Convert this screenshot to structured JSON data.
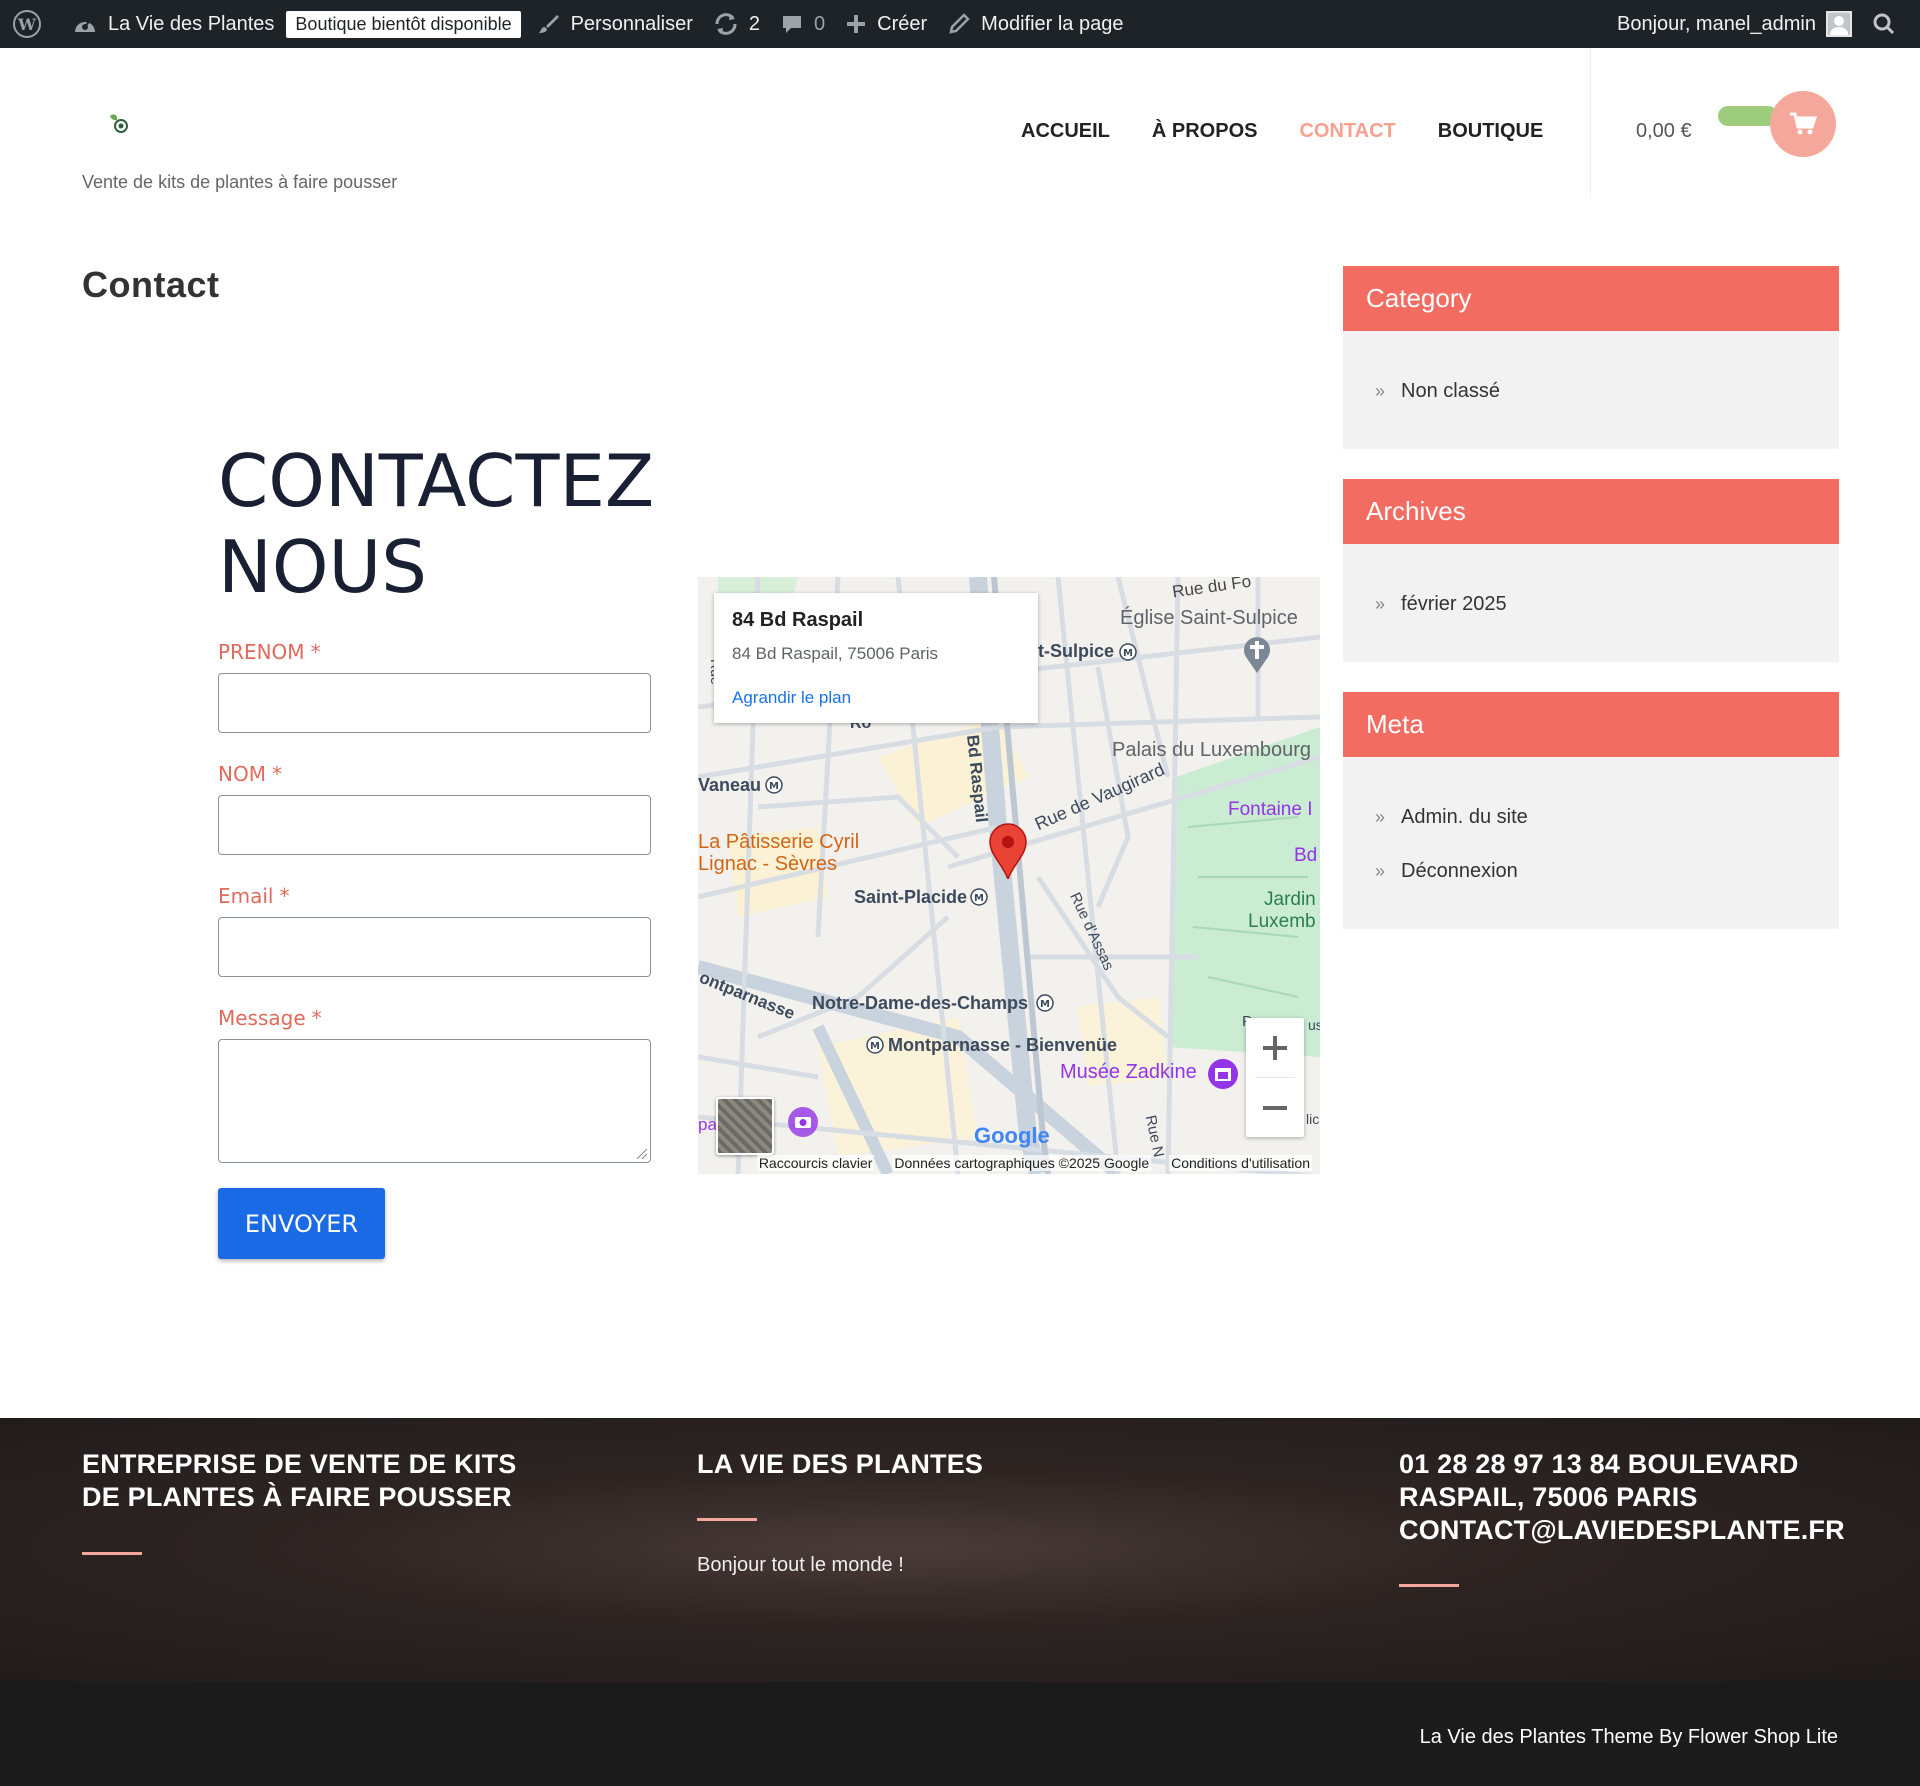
{
  "admin_bar": {
    "site_name": "La Vie des Plantes",
    "shop_badge": "Boutique bientôt disponible",
    "customize": "Personnaliser",
    "updates_count": "2",
    "comments_count": "0",
    "new": "Créer",
    "edit_page": "Modifier la page",
    "greeting": "Bonjour, manel_admin"
  },
  "header": {
    "tagline": "Vente de kits de plantes à faire pousser",
    "nav": [
      "ACCUEIL",
      "À PROPOS",
      "CONTACT",
      "BOUTIQUE"
    ],
    "active_nav": "CONTACT",
    "cart_total": "0,00 €"
  },
  "page": {
    "title": "Contact"
  },
  "contact_form": {
    "heading_line1": "CONTACTEZ",
    "heading_line2": "NOUS",
    "fields": [
      {
        "label": "PRENOM",
        "required": "*"
      },
      {
        "label": "NOM",
        "required": "*"
      },
      {
        "label": "Email",
        "required": "*"
      },
      {
        "label": "Message",
        "required": "*"
      }
    ],
    "submit": "ENVOYER"
  },
  "map": {
    "place_title": "84 Bd Raspail",
    "place_address": "84 Bd Raspail, 75006 Paris",
    "enlarge_link": "Agrandir le plan",
    "labels": {
      "rue_du_four": "Rue du Fo",
      "eglise": "Église Saint-Sulpice",
      "st_sulpice": "t-Sulpice",
      "palais": "Palais du Luxembourg",
      "vaneau": "Vaneau",
      "fontaine": "Fontaine I",
      "bd": "Bd",
      "jardin1": "Jardin",
      "jardin2": "Luxemb",
      "patisserie1": "La Pâtisserie Cyril",
      "patisserie2": "Lignac - Sèvres",
      "rue_vaugirard": "Rue de Vaugirard",
      "rue_assas": "Rue d'Assas",
      "bd_raspail": "Bd Raspail",
      "saint_placide": "Saint-Placide",
      "montparnasse_street": "ontparnasse",
      "notre_dame": "Notre-Dame-des-Champs",
      "montparnasse_station": "Montparnasse - Bienvenüe",
      "musee": "Musée Zadkine",
      "google": "Google",
      "rue_n": "Rue N",
      "us_fragment": "us",
      "lic_fragment": "lic",
      "pa_fragment": "pa",
      "rue_fragment": "Rue",
      "ro_fragment": "Ro",
      "p_fragment": "P"
    },
    "footer": {
      "shortcuts": "Raccourcis clavier",
      "data": "Données cartographiques ©2025 Google",
      "terms": "Conditions d'utilisation"
    },
    "colors": {
      "pin": "#ea4335",
      "park": "#c9ecd2",
      "poi_purple": "#9334e6",
      "poi_orange": "#d26515"
    }
  },
  "sidebar": {
    "widgets": [
      {
        "title": "Category",
        "items": [
          "Non classé"
        ]
      },
      {
        "title": "Archives",
        "items": [
          "février 2025"
        ]
      },
      {
        "title": "Meta",
        "items": [
          "Admin. du site",
          "Déconnexion"
        ]
      }
    ]
  },
  "footer": {
    "col1_title": "ENTREPRISE DE VENTE DE KITS DE PLANTES À FAIRE POUSSER",
    "col2_title": "LA VIE DES PLANTES",
    "col2_link": "Bonjour tout le monde !",
    "col3_title": "01 28 28 97 13 84 BOULEVARD RASPAIL, 75006 PARIS CONTACT@LAVIEDESPLANTE.FR",
    "copyright": "La Vie des Plantes Theme By Flower Shop Lite"
  },
  "colors": {
    "accent": "#f36c62",
    "nav_active": "#f8a08f",
    "button_blue": "#1a6ae5",
    "label_red": "#e06a5c",
    "admin_bar": "#1d2327"
  },
  "icons": [
    "wordpress-icon",
    "dashboard-icon",
    "brush-icon",
    "update-icon",
    "comment-icon",
    "plus-icon",
    "pencil-icon",
    "search-icon",
    "cart-icon",
    "chevron-right-icon",
    "map-pin-icon",
    "zoom-in-icon",
    "zoom-out-icon"
  ]
}
